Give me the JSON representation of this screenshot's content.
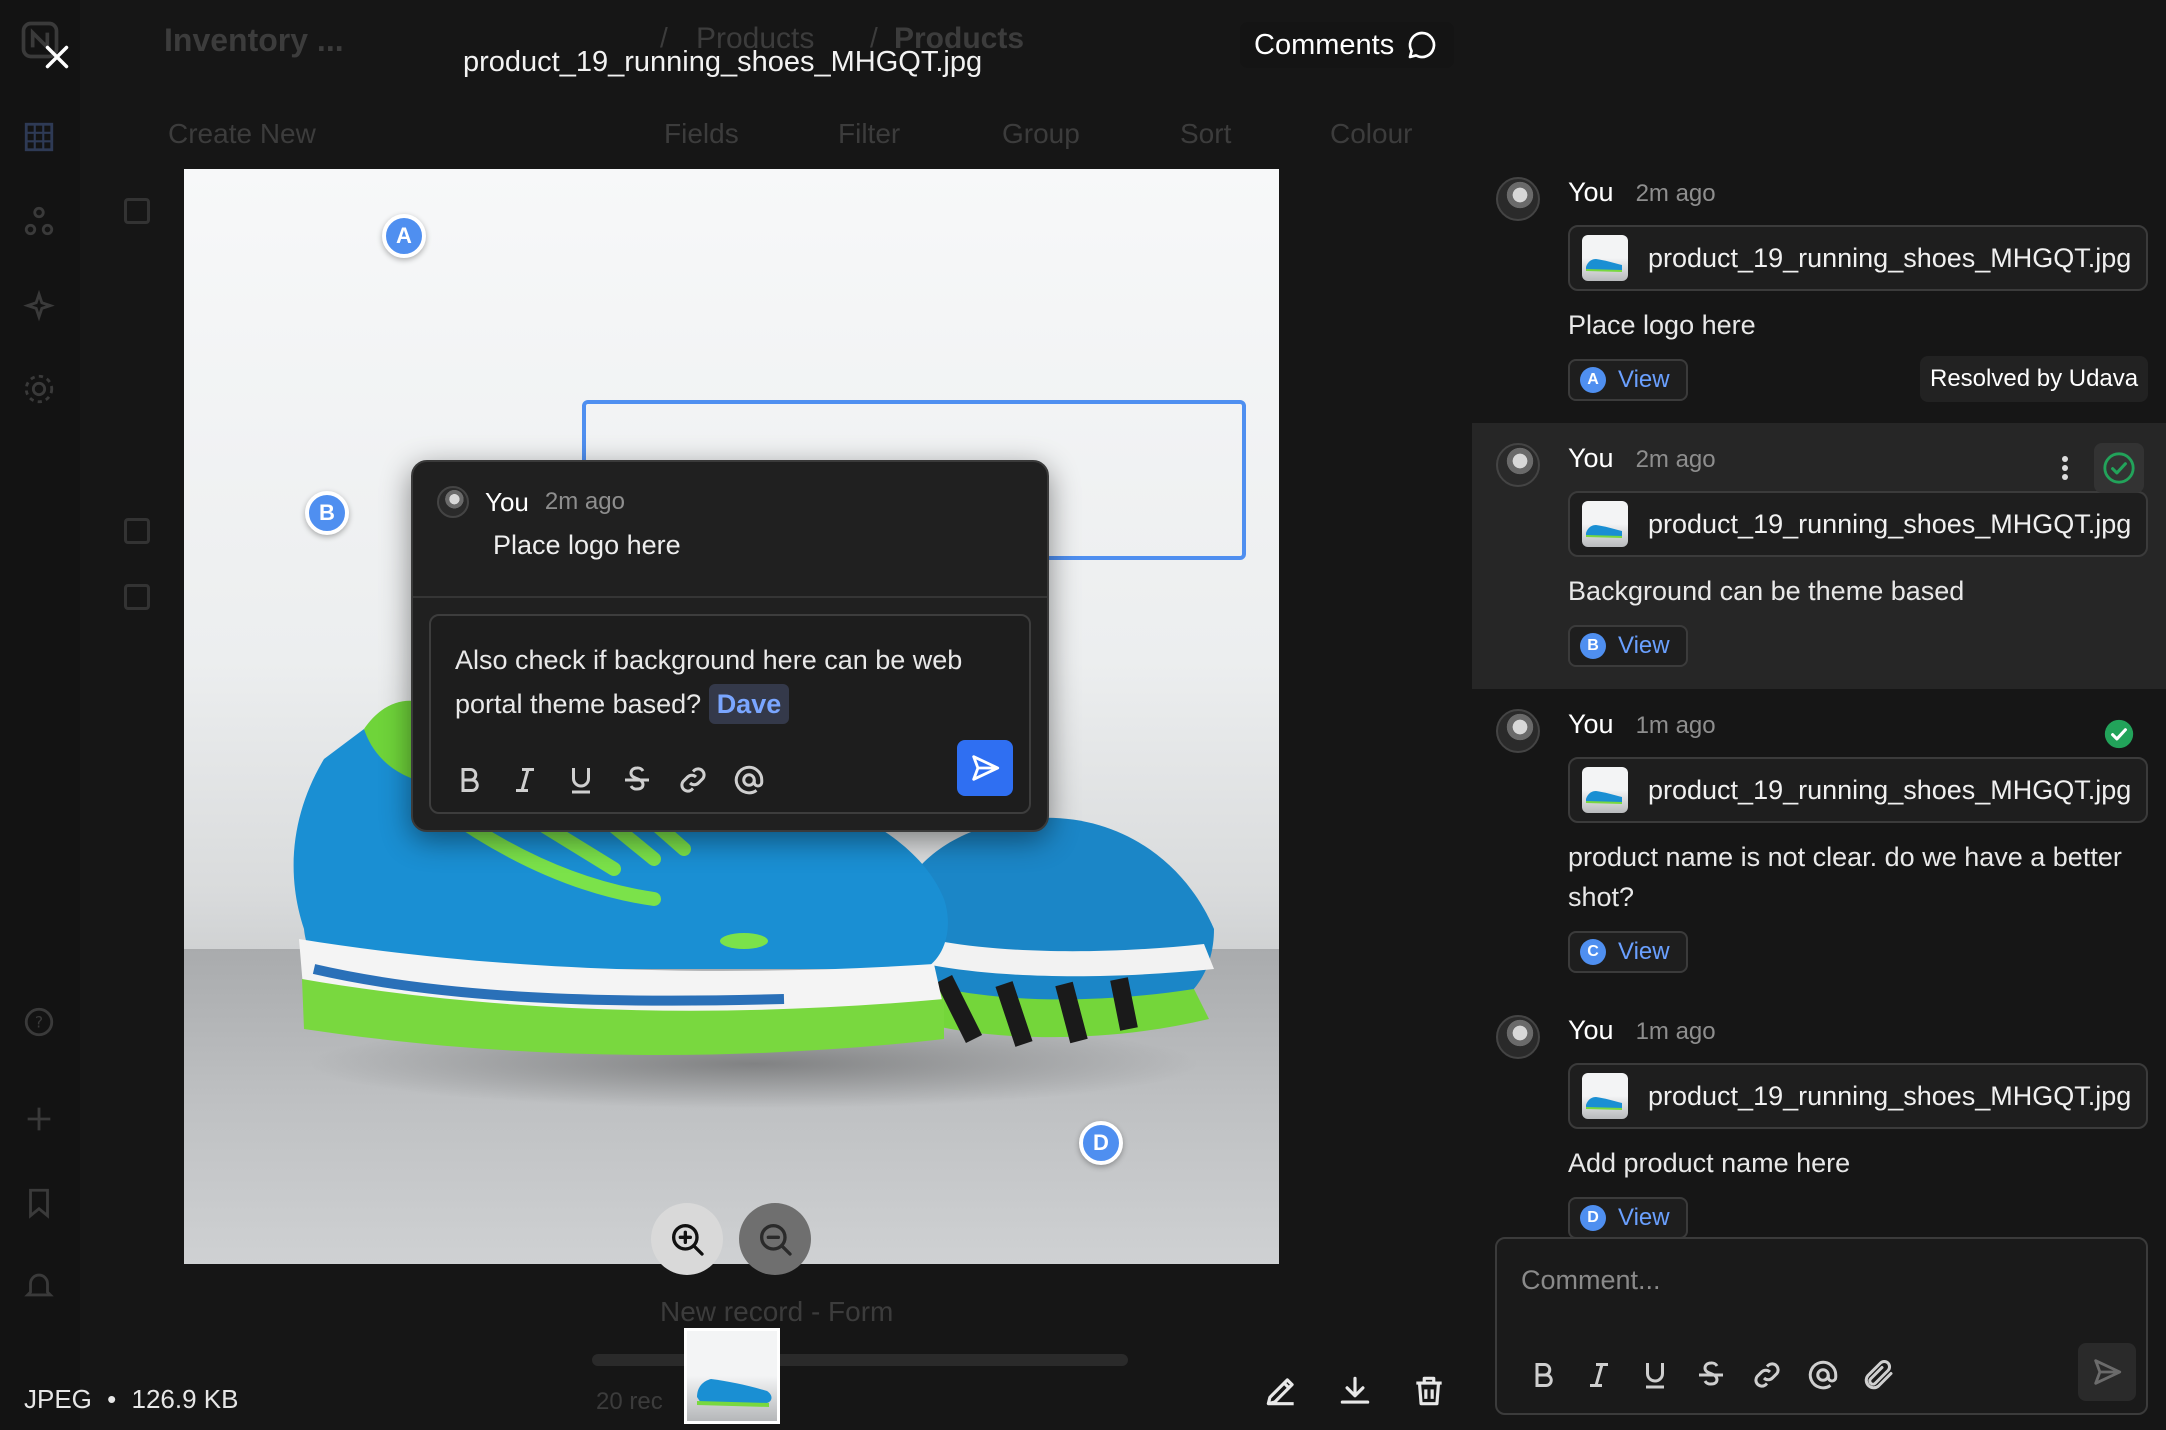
{
  "background_app": {
    "workspace_name": "Inventory ...",
    "breadcrumb": [
      "Products",
      "Products"
    ],
    "create_new_label": "Create New",
    "toolbar": [
      "Fields",
      "Filter",
      "Group",
      "Sort",
      "Colour"
    ],
    "new_record_label": "New record - Form",
    "record_count_fragment": "20 rec"
  },
  "viewer": {
    "file_name": "product_19_running_shoes_MHGQT.jpg",
    "comments_toggle_label": "Comments",
    "file_type": "JPEG",
    "file_size": "126.9 KB",
    "separator": "•",
    "markers": [
      "A",
      "B",
      "D"
    ]
  },
  "popup": {
    "author": "You",
    "time": "2m ago",
    "text": "Place logo here",
    "reply_text": "Also check if background here can be web portal theme based?",
    "mention": "Dave"
  },
  "comments": [
    {
      "author": "You",
      "time": "2m ago",
      "file": "product_19_running_shoes_MHGQT.jpg",
      "text": "Place logo here",
      "marker": "A",
      "view_label": "View"
    },
    {
      "author": "You",
      "time": "2m ago",
      "file": "product_19_running_shoes_MHGQT.jpg",
      "text": "Background can be theme based",
      "marker": "B",
      "view_label": "View"
    },
    {
      "author": "You",
      "time": "1m ago",
      "file": "product_19_running_shoes_MHGQT.jpg",
      "text": "product name is not clear. do we have a better shot?",
      "marker": "C",
      "view_label": "View"
    },
    {
      "author": "You",
      "time": "1m ago",
      "file": "product_19_running_shoes_MHGQT.jpg",
      "text": "Add product name here",
      "marker": "D",
      "view_label": "View"
    }
  ],
  "tooltip": "Resolved by Udava",
  "composer": {
    "placeholder": "Comment..."
  },
  "icons": {
    "close": "close-icon",
    "comments": "speech-bubble-icon",
    "zoom_in": "zoom-in-icon",
    "zoom_out": "zoom-out-icon",
    "edit": "pencil-icon",
    "download": "download-icon",
    "delete": "trash-icon",
    "more": "kebab-icon",
    "resolved": "check-circle-icon",
    "send": "send-icon",
    "attach": "paperclip-icon"
  },
  "colors": {
    "accent": "#4f8ff0",
    "send": "#2f6ff2",
    "resolved": "#22a35a",
    "link": "#6aa0ff"
  }
}
